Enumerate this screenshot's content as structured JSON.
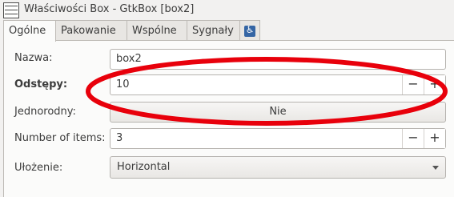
{
  "window": {
    "title": "Właściwości Box - GtkBox [box2]"
  },
  "tabs": [
    {
      "label": "Ogólne"
    },
    {
      "label": "Pakowanie"
    },
    {
      "label": "Wspólne"
    },
    {
      "label": "Sygnały"
    },
    {
      "icon": "accessibility-icon"
    }
  ],
  "form": {
    "name_label": "Nazwa:",
    "name_value": "box2",
    "spacing_label": "Odstępy:",
    "spacing_value": "10",
    "homogeneous_label": "Jednorodny:",
    "homogeneous_value": "Nie",
    "items_label": "Number of items:",
    "items_value": "3",
    "orientation_label": "Ułożenie:",
    "orientation_value": "Horizontal",
    "minus": "−",
    "plus": "+"
  },
  "annotation": {
    "color": "#e8000b"
  }
}
